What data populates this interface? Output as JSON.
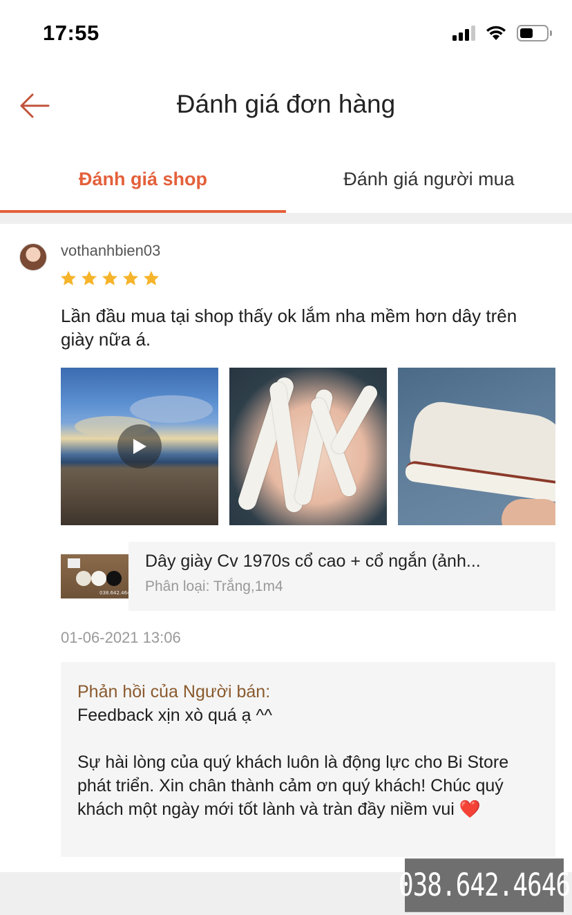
{
  "status_bar": {
    "time": "17:55",
    "battery_level": 0.5
  },
  "header": {
    "title": "Đánh giá đơn hàng",
    "back_icon": "arrow-left-icon",
    "accent_color": "#e4603b"
  },
  "tabs": [
    {
      "label": "Đánh giá shop",
      "active": true
    },
    {
      "label": "Đánh giá người mua",
      "active": false
    }
  ],
  "review": {
    "username": "vothanhbien03",
    "rating": 5,
    "text": "Lần đầu mua tại shop thấy ok lắm nha mềm hơn dây trên giày nữa á.",
    "media": [
      {
        "type": "video",
        "icon": "play-icon"
      },
      {
        "type": "photo"
      },
      {
        "type": "photo"
      }
    ],
    "product": {
      "name": "Dây giày Cv 1970s cổ cao + cổ ngắn (ảnh...",
      "variant": "Phân loại: Trắng,1m4",
      "thumb_text": "038.642.4646"
    },
    "date": "01-06-2021 13:06",
    "seller_reply": {
      "title": "Phản hồi của Người bán:",
      "body": "Feedback xịn xò quá ạ ^^\n\nSự hài lòng của quý khách luôn là động lực cho Bi Store phát triển. Xin chân thành cảm ơn quý khách! Chúc quý khách một ngày mới tốt lành và tràn đầy niềm vui ❤️"
    }
  },
  "watermark": "038.642.4646"
}
